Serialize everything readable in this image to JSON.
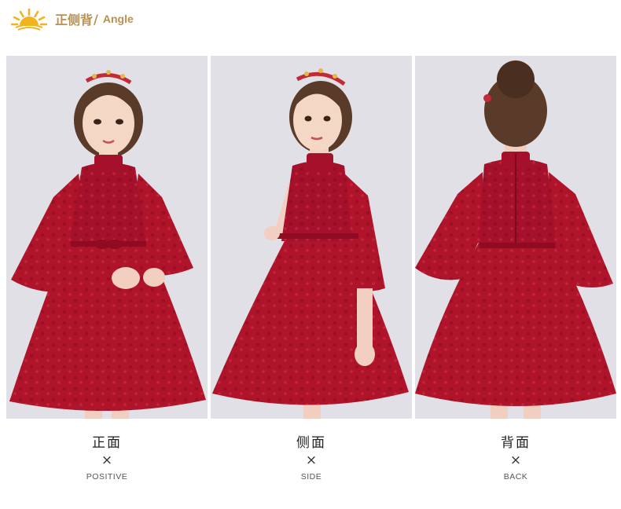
{
  "header": {
    "title_cn": "正侧背",
    "separator": "/",
    "title_en": "Angle",
    "icon": "sun-icon",
    "accent": "#b89150"
  },
  "photos": [
    {
      "view": "front",
      "cn": "正面",
      "mark": "×",
      "en": "POSITIVE"
    },
    {
      "view": "side",
      "cn": "侧面",
      "mark": "×",
      "en": "SIDE"
    },
    {
      "view": "back",
      "cn": "背面",
      "mark": "×",
      "en": "BACK"
    }
  ],
  "colors": {
    "dress": "#b0142a",
    "background": "#e0e0e6",
    "hair": "#5a3a28",
    "skin": "#f5d7c6"
  }
}
